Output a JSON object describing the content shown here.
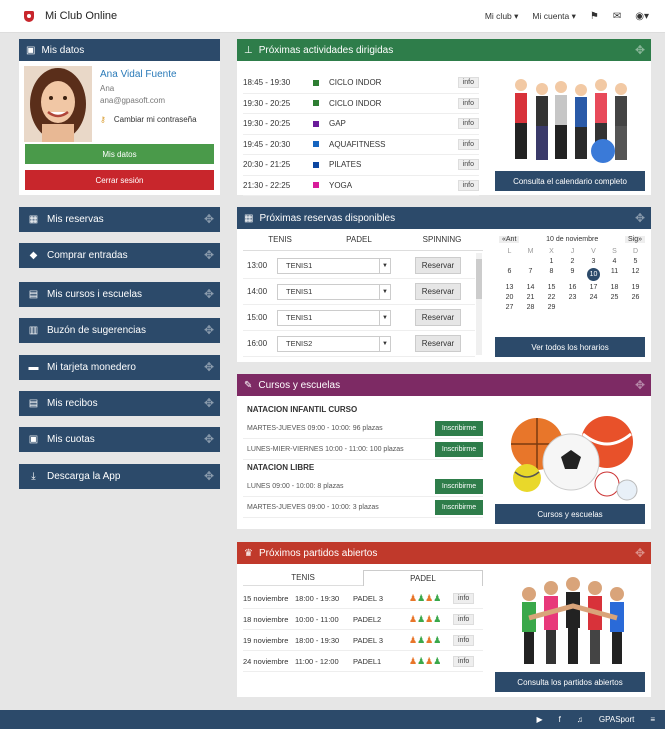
{
  "app": {
    "title": "Mi Club Online",
    "menu": [
      "Mi club ▾",
      "Mi cuenta ▾"
    ]
  },
  "profile": {
    "header": "Mis datos",
    "name": "Ana Vidal Fuente",
    "short_name": "Ana",
    "email": "ana@gpasoft.com",
    "change_password": "Cambiar mi contraseña",
    "my_data_button": "Mis datos",
    "logout_button": "Cerrar sesión"
  },
  "sidebar": [
    {
      "label": "Mis reservas",
      "icon": "calendar-icon"
    },
    {
      "label": "Comprar entradas",
      "icon": "ticket-icon"
    },
    {
      "label": "Mis cursos i escuelas",
      "icon": "courses-icon"
    },
    {
      "label": "Buzón de sugerencias",
      "icon": "mailbox-icon"
    },
    {
      "label": "Mi tarjeta monedero",
      "icon": "wallet-card-icon"
    },
    {
      "label": "Mis recibos",
      "icon": "receipt-icon"
    },
    {
      "label": "Mis cuotas",
      "icon": "fees-icon"
    },
    {
      "label": "Descarga la App",
      "icon": "download-icon"
    }
  ],
  "activities": {
    "header": "Próximas actividades dirigidas",
    "info_label": "info",
    "button": "Consulta el calendario completo",
    "rows": [
      {
        "time": "18:45 - 19:30",
        "name": "CICLO INDOR",
        "color": "#2e7d32"
      },
      {
        "time": "19:30 - 20:25",
        "name": "CICLO INDOR",
        "color": "#2e7d32"
      },
      {
        "time": "19:30 - 20:25",
        "name": "GAP",
        "color": "#6a1b9a"
      },
      {
        "time": "19:45 - 20:30",
        "name": "AQUAFITNESS",
        "color": "#1565c0"
      },
      {
        "time": "20:30 - 21:25",
        "name": "PILATES",
        "color": "#0d47a1"
      },
      {
        "time": "21:30 - 22:25",
        "name": "YOGA",
        "color": "#d81b9a"
      }
    ]
  },
  "reservations": {
    "header": "Próximas reservas disponibles",
    "tabs": [
      "TENIS",
      "PADEL",
      "SPINNING"
    ],
    "reserve_label": "Reservar",
    "rows": [
      {
        "time": "13:00",
        "court": "TENIS1"
      },
      {
        "time": "14:00",
        "court": "TENIS1"
      },
      {
        "time": "15:00",
        "court": "TENIS1"
      },
      {
        "time": "16:00",
        "court": "TENIS2"
      }
    ],
    "calendar": {
      "prev": "«Ant",
      "month": "10 de noviembre",
      "next": "Sig»",
      "dow": [
        "L",
        "M",
        "X",
        "J",
        "V",
        "S",
        "D"
      ],
      "days": [
        "",
        "",
        "1",
        "2",
        "3",
        "4",
        "5",
        "6",
        "7",
        "8",
        "9",
        "10",
        "11",
        "12",
        "13",
        "14",
        "15",
        "16",
        "17",
        "18",
        "19",
        "20",
        "21",
        "22",
        "23",
        "24",
        "25",
        "26",
        "27",
        "28",
        "29",
        "",
        "",
        "",
        "",
        "",
        ""
      ],
      "today": "10"
    },
    "button": "Ver todos los horarios"
  },
  "courses": {
    "header": "Cursos y escuelas",
    "enroll_label": "Inscribirme",
    "button": "Cursos y escuelas",
    "groups": [
      {
        "title": "NATACION INFANTIL CURSO",
        "items": [
          "MARTES-JUEVES 09:00 - 10:00: 96 plazas",
          "LUNES-MIER-VIERNES 10:00 - 11:00: 100 plazas"
        ]
      },
      {
        "title": "NATACION LIBRE",
        "items": [
          "LUNES 09:00 - 10:00: 8 plazas",
          "MARTES-JUEVES 09:00 - 10:00: 3 plazas"
        ]
      }
    ]
  },
  "matches": {
    "header": "Próximos partidos abiertos",
    "tabs": [
      "TENIS",
      "PADEL"
    ],
    "info_label": "info",
    "button": "Consulta los partidos abiertos",
    "rows": [
      {
        "date": "15 noviembre",
        "time": "18:00 - 19:30",
        "court": "PADEL 3"
      },
      {
        "date": "18 noviembre",
        "time": "10:00 - 11:00",
        "court": "PADEL2"
      },
      {
        "date": "19 noviembre",
        "time": "18:00 - 19:30",
        "court": "PADEL 3"
      },
      {
        "date": "24 noviembre",
        "time": "11:00 - 12:00",
        "court": "PADEL1"
      }
    ]
  },
  "footer": {
    "brand": "GPASport"
  },
  "colors": {
    "navy": "#2c4a6a",
    "green": "#2e7d4a",
    "purple": "#7d2a64",
    "red": "#c0392b",
    "logout": "#c8262c",
    "my_data": "#4a9a4a"
  }
}
